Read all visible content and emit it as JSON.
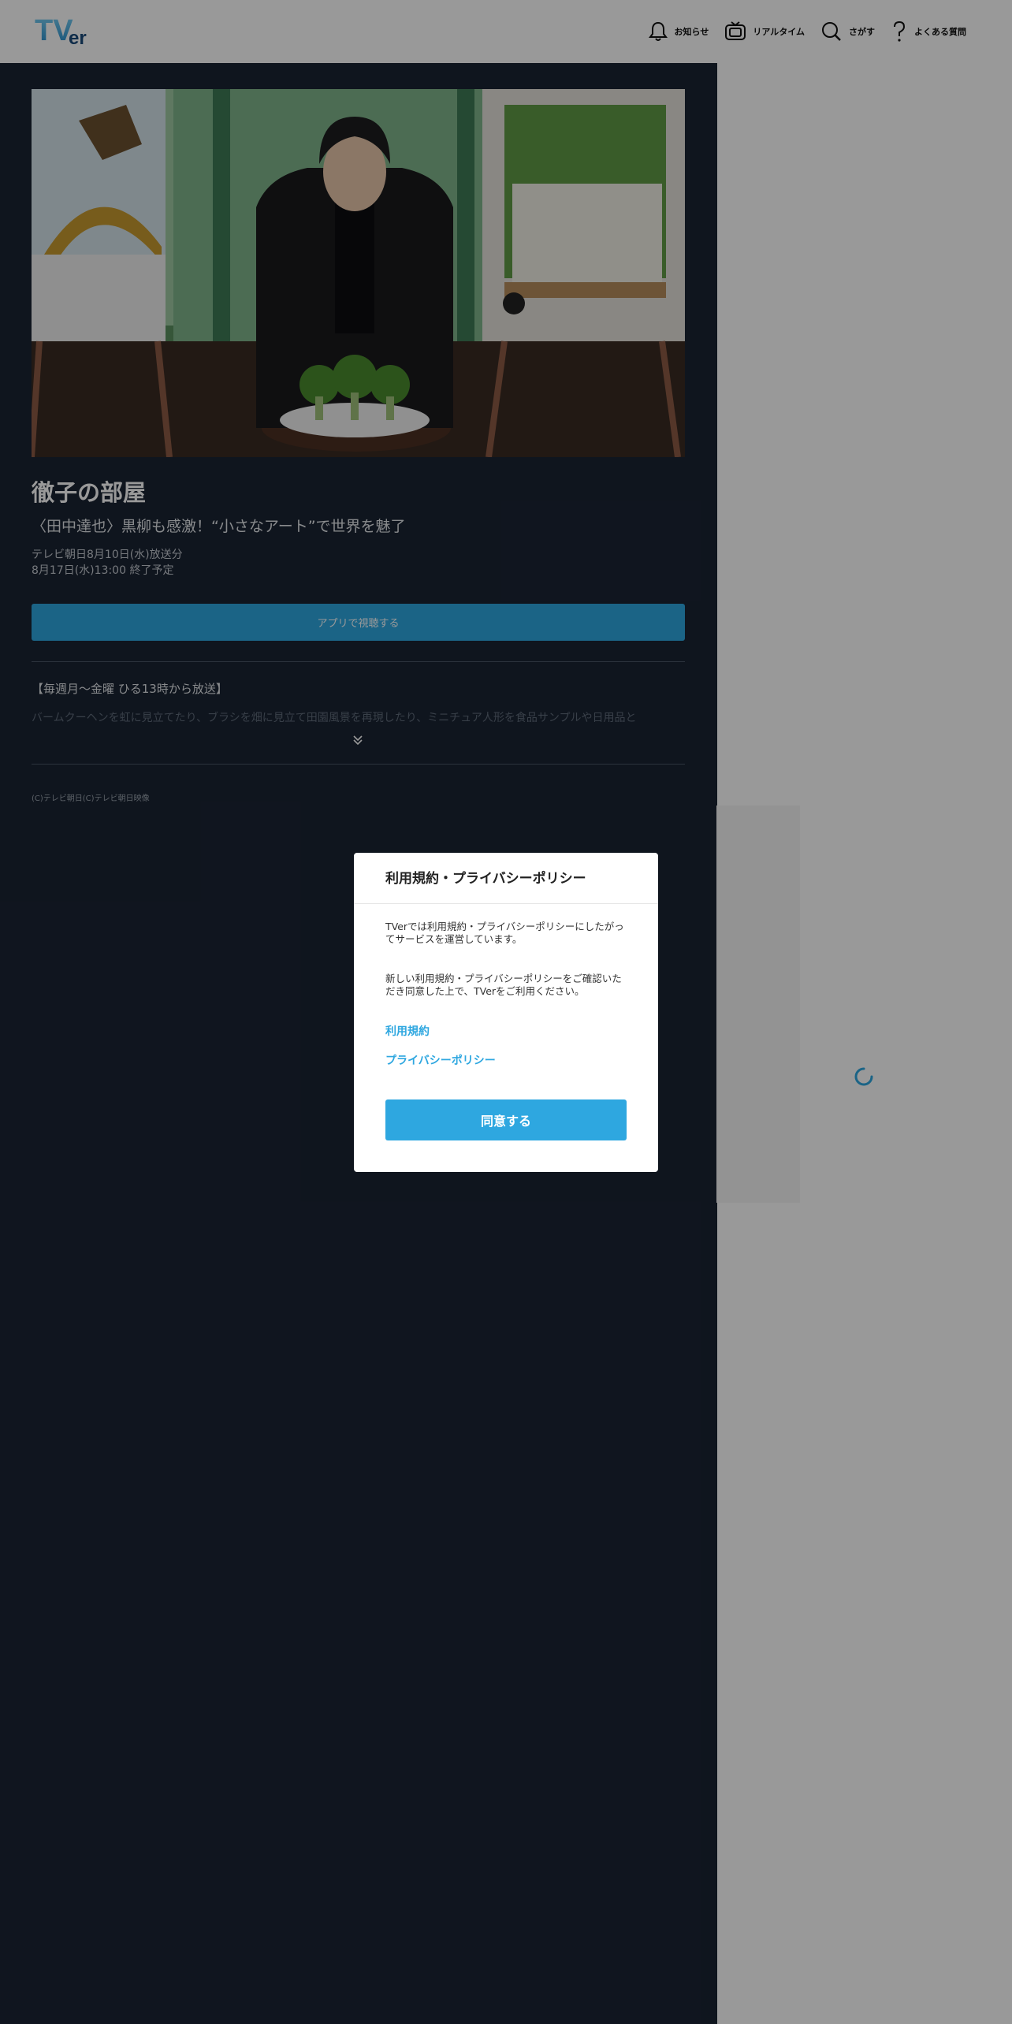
{
  "header": {
    "logo_text": "TVer",
    "nav": [
      {
        "label": "お知らせ",
        "icon": "bell-icon"
      },
      {
        "label": "リアルタイム",
        "icon": "tv-icon"
      },
      {
        "label": "さがす",
        "icon": "search-icon"
      },
      {
        "label": "よくある質問",
        "icon": "question-icon"
      }
    ]
  },
  "episode": {
    "title": "徹子の部屋",
    "subtitle": "〈田中達也〉黒柳も感激！“小さなアート”で世界を魅了",
    "broadcast": "テレビ朝日8月10日(水)放送分",
    "end": "8月17日(水)13:00 終了予定",
    "app_button": "アプリで視聴する",
    "description_heading": "【毎週月～金曜 ひる13時から放送】",
    "description_preview": "バームクーヘンを虹に見立てたり、ブラシを畑に見立て田園風景を再現したり、ミニチュア人形を食品サンプルや日用品と",
    "copyright": "(C)テレビ朝日(C)テレビ朝日映像"
  },
  "modal": {
    "title": "利用規約・プライバシーポリシー",
    "text1": "TVerでは利用規約・プライバシーポリシーにしたがってサービスを運営しています。",
    "text2": "新しい利用規約・プライバシーポリシーをご確認いただき同意した上で、TVerをご利用ください。",
    "link_terms": "利用規約",
    "link_privacy": "プライバシーポリシー",
    "agree_button": "同意する"
  },
  "colors": {
    "accent": "#2ea7e0",
    "panel": "#1a2333",
    "overlay": "rgba(0,0,0,0.4)"
  }
}
